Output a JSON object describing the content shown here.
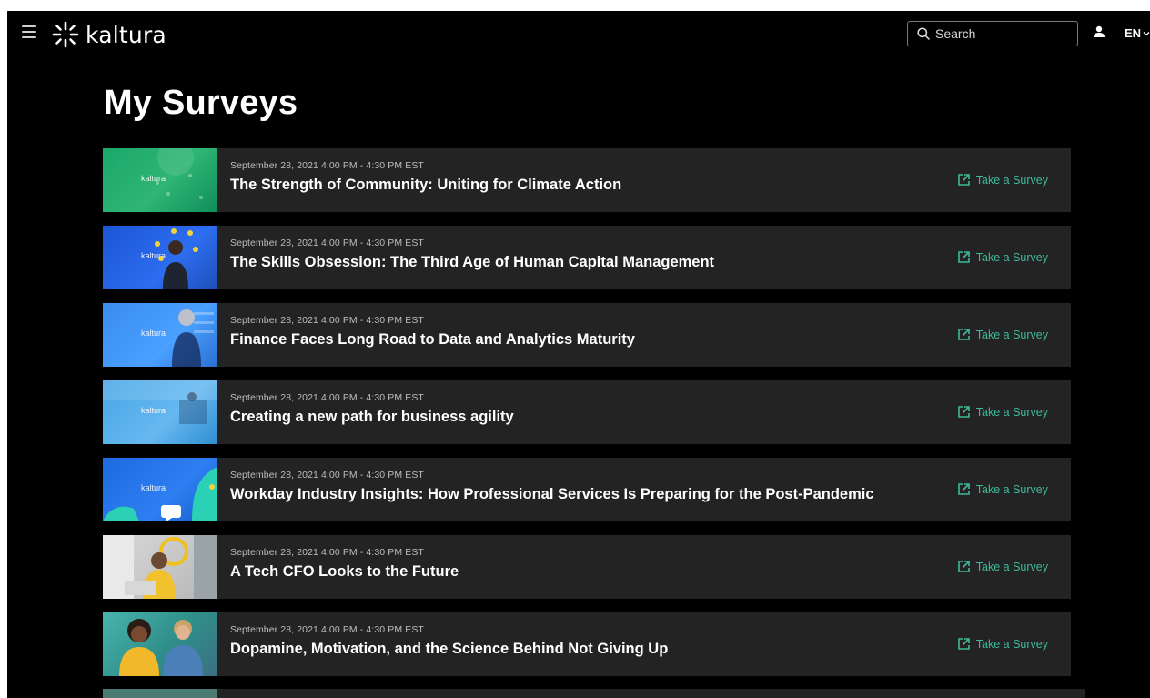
{
  "header": {
    "logo_text": "kaltura",
    "search": {
      "placeholder": "Search",
      "value": ""
    },
    "language": "EN"
  },
  "page": {
    "title": "My Surveys"
  },
  "survey_action_label": "Take a Survey",
  "colors": {
    "accent": "#3fb89a",
    "row_bg": "#232323",
    "page_bg": "#000000"
  },
  "surveys": [
    {
      "date": "September 28, 2021  4:00 PM - 4:30 PM EST",
      "title": "The Strength of Community: Uniting for Climate Action",
      "thumb_logo": "kaltura"
    },
    {
      "date": "September 28, 2021  4:00 PM - 4:30 PM EST",
      "title": "The Skills Obsession: The Third Age of Human Capital Management",
      "thumb_logo": "kaltura"
    },
    {
      "date": "September 28, 2021  4:00 PM - 4:30 PM EST",
      "title": "Finance Faces Long Road to Data and Analytics Maturity",
      "thumb_logo": "kaltura"
    },
    {
      "date": "September 28, 2021  4:00 PM - 4:30 PM EST",
      "title": "Creating a new path for business agility",
      "thumb_logo": "kaltura"
    },
    {
      "date": "September 28, 2021  4:00 PM - 4:30 PM EST",
      "title": "Workday Industry Insights: How Professional Services Is Preparing for the Post-Pandemic",
      "thumb_logo": "kaltura"
    },
    {
      "date": "September 28, 2021  4:00 PM - 4:30 PM EST",
      "title": "A Tech CFO Looks to the Future",
      "thumb_logo": ""
    },
    {
      "date": "September 28, 2021  4:00 PM - 4:30 PM EST",
      "title": "Dopamine, Motivation, and the Science Behind Not Giving Up",
      "thumb_logo": ""
    }
  ]
}
